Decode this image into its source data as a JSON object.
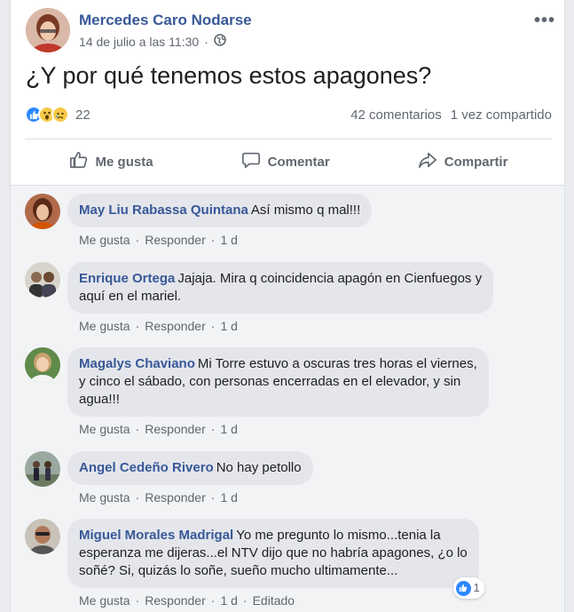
{
  "post": {
    "author": "Mercedes Caro Nodarse",
    "date": "14 de julio a las 11:30",
    "separator": "·",
    "more": "•••",
    "text": "¿Y por qué tenemos estos apagones?",
    "reaction_count": "22",
    "comments_count": "42 comentarios",
    "shares_count": "1 vez compartido"
  },
  "actions": {
    "like": "Me gusta",
    "comment": "Comentar",
    "share": "Compartir"
  },
  "comment_links": {
    "like": "Me gusta",
    "reply": "Responder",
    "dot": "·"
  },
  "comments": [
    {
      "name": "May Liu Rabassa Quintana",
      "text": "Así mismo q mal!!!",
      "time": "1 d"
    },
    {
      "name": "Enrique Ortega",
      "text": "Jajaja. Mira q coincidencia apagón en Cienfuegos y",
      "text2": "aquí en el mariel.",
      "time": "1 d"
    },
    {
      "name": "Magalys Chaviano",
      "text": "Mi Torre estuvo a oscuras tres horas el viernes,",
      "text2": "y cinco el sábado, con personas encerradas en el elevador, y sin",
      "text3": "agua!!!",
      "time": "1 d"
    },
    {
      "name": "Angel Cedeño Rivero",
      "text": "No hay petollo",
      "time": "1 d"
    },
    {
      "name": "Miguel Morales Madrigal",
      "text": "Yo me pregunto lo mismo...tenia la",
      "text2": "esperanza me dijeras...el NTV dijo que no habría apagones, ¿o lo",
      "text3": "soñé? Si, quizás lo soñe, sueño mucho ultimamente...",
      "time": "1 d",
      "edited": "Editado",
      "likes": "1"
    }
  ]
}
